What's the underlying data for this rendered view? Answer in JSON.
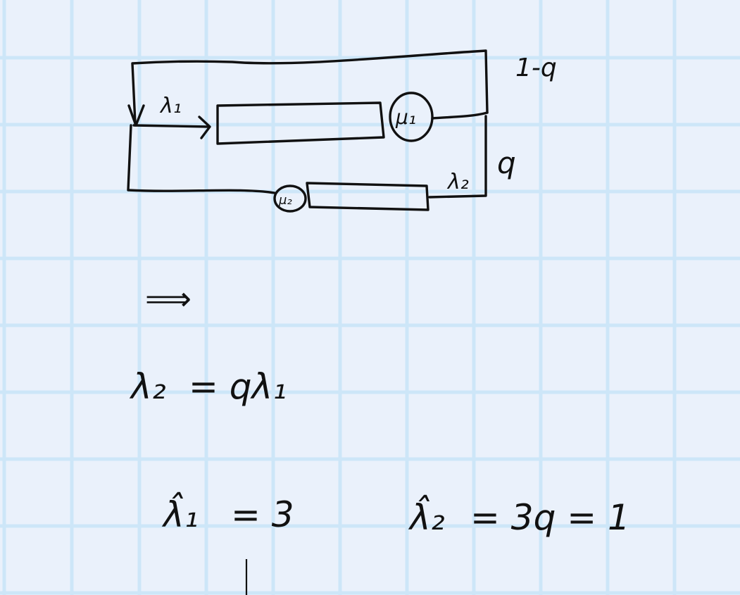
{
  "diagram": {
    "arrival_rate_1": "λ₁",
    "arrival_rate_2": "λ₂",
    "server_1": "μ₁",
    "server_2": "μ₂",
    "branch_top": "1-q",
    "branch_right": "q"
  },
  "equations": {
    "implies": "⟹",
    "eq1_lhs": "λ₂",
    "eq1_rhs": "= qλ₁",
    "eq2_lhs": "λ̂₁",
    "eq2_rhs": "= 3",
    "eq3_lhs": "λ̂₂",
    "eq3_rhs": "= 3q = 1"
  }
}
